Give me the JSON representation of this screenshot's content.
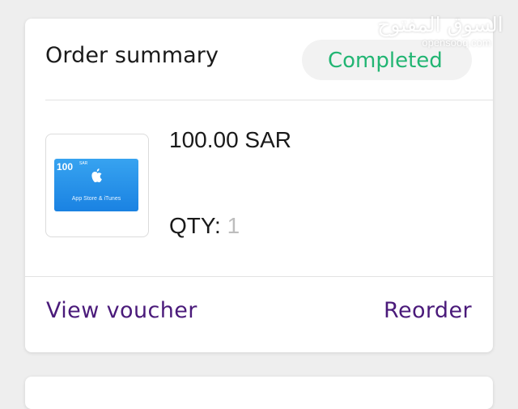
{
  "order_summary": {
    "title": "Order summary",
    "status": "Completed",
    "status_color": "#22b573"
  },
  "item": {
    "image": {
      "amount": "100",
      "currency": "SAR",
      "caption": "App Store & iTunes",
      "logo_icon": "apple-logo-icon"
    },
    "price": "100.00 SAR",
    "qty_label": "QTY:",
    "qty_value": "1"
  },
  "actions": {
    "view_voucher": "View voucher",
    "reorder": "Reorder",
    "link_color": "#4a1a7a"
  },
  "watermark": {
    "arabic": "السوق المفتوح",
    "latin": "opensooq.com"
  }
}
